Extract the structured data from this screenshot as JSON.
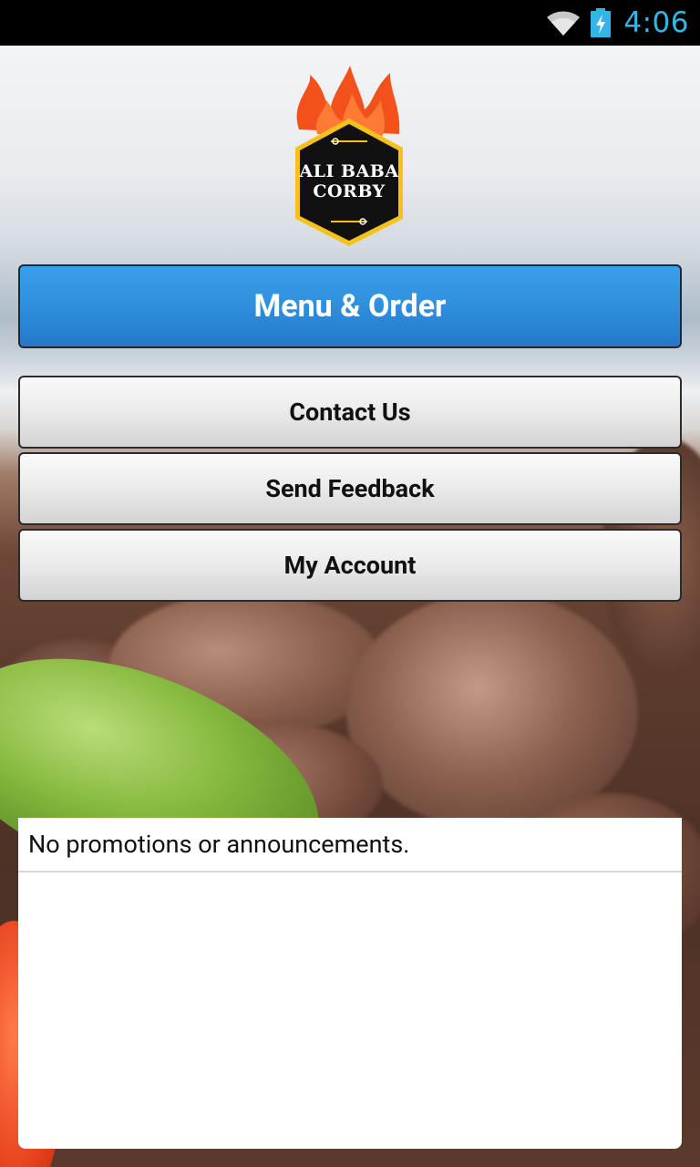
{
  "status_bar": {
    "time": "4:06",
    "wifi_icon": "wifi-icon",
    "battery_icon": "battery-charging-icon",
    "clock_color": "#33b5e5"
  },
  "logo": {
    "line1": "ALI BABA",
    "line2": "CORBY",
    "flame_color": "#f2511b",
    "badge_color": "#111111",
    "border_color": "#f5c21b"
  },
  "buttons": {
    "menu_order": "Menu & Order",
    "contact_us": "Contact Us",
    "send_feedback": "Send Feedback",
    "my_account": "My Account"
  },
  "colors": {
    "primary_button": "#2f8fde",
    "secondary_button": "#e6e6e6"
  },
  "announcements": {
    "message": "No promotions or announcements."
  }
}
